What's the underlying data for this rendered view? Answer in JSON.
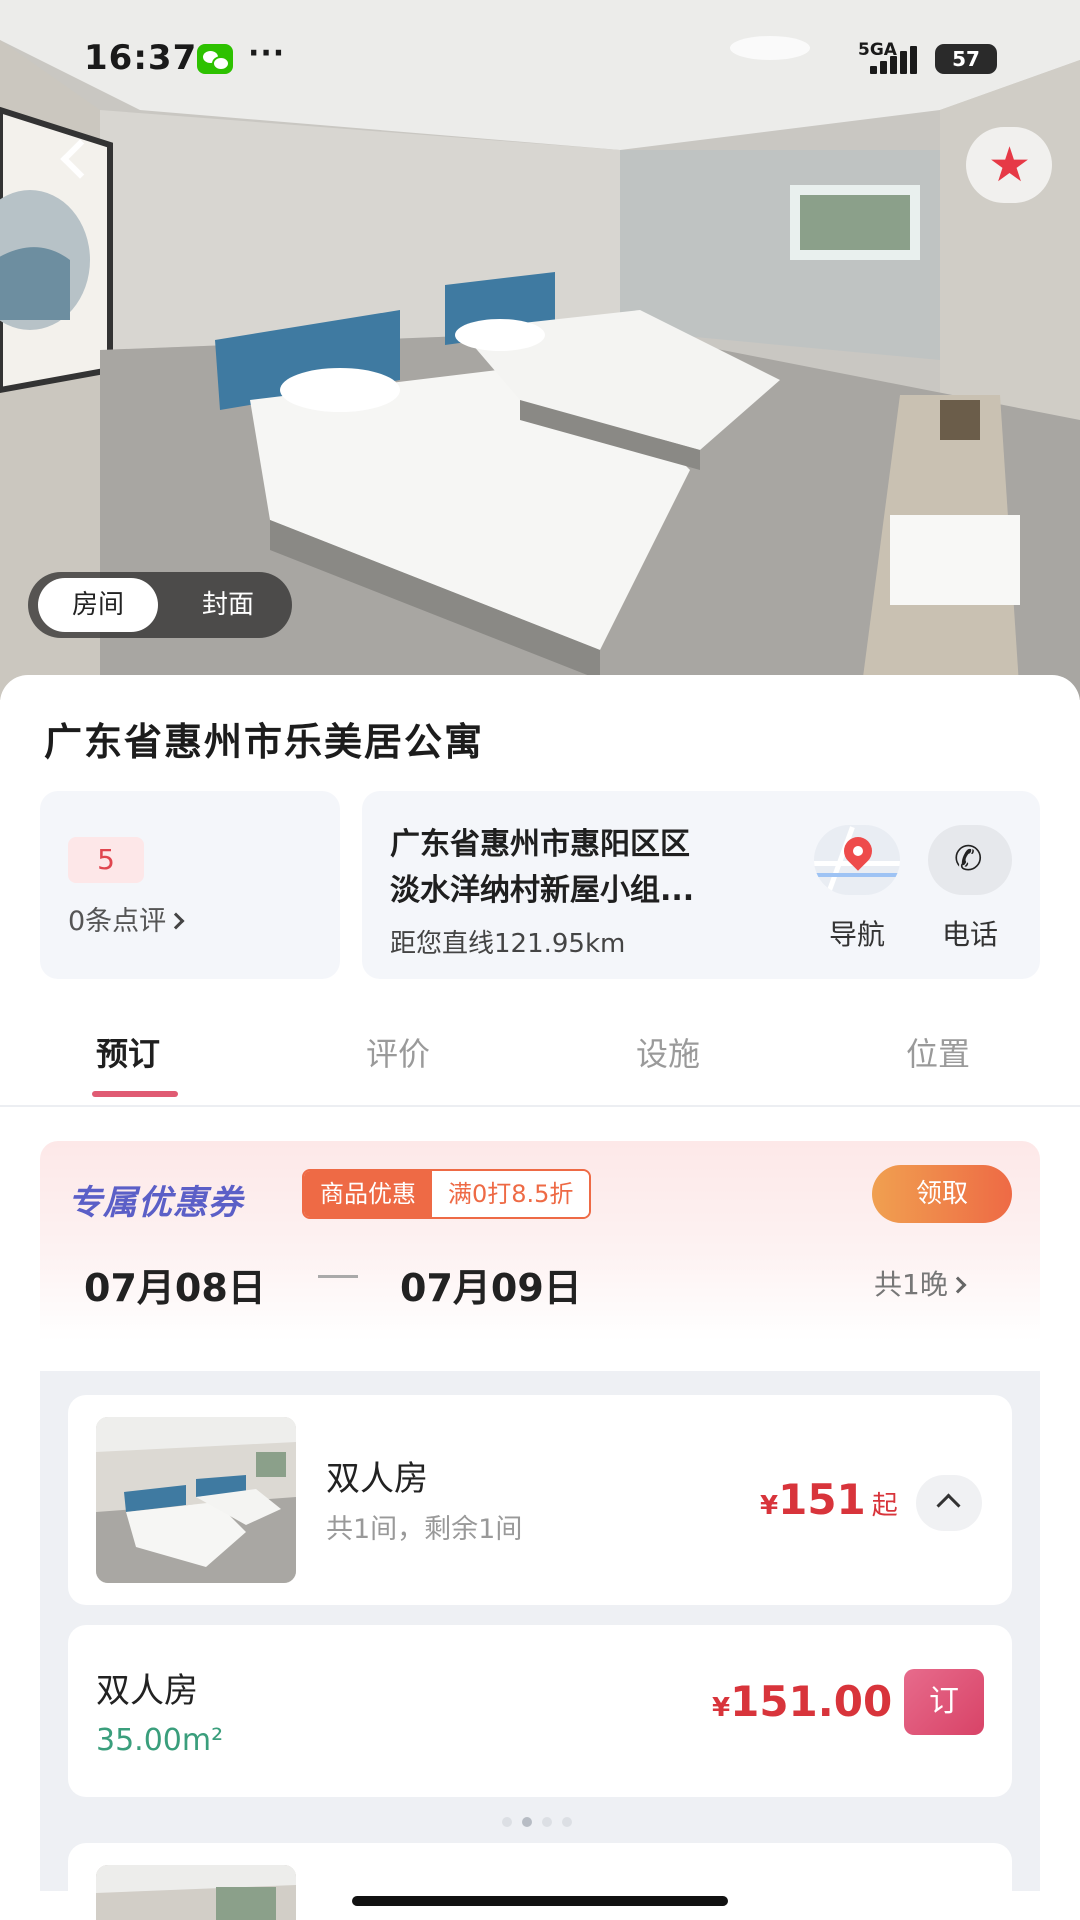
{
  "status_bar": {
    "time": "16:37",
    "extra": "···",
    "network": "5GA",
    "battery": "57",
    "icons": [
      "wechat-icon",
      "signal-icon",
      "battery-icon"
    ]
  },
  "hero": {
    "segments": [
      "房间",
      "封面"
    ],
    "active_segment": "房间",
    "icons": [
      "back-icon",
      "star-icon"
    ]
  },
  "hotel": {
    "name": "广东省惠州市乐美居公寓",
    "score": "5",
    "reviews": "0条点评",
    "address_line1": "广东省惠州市惠阳区区",
    "address_line2": "淡水洋纳村新屋小组...",
    "distance": "距您直线121.95km",
    "nav_label": "导航",
    "phone_label": "电话",
    "icons": [
      "map-pin-icon",
      "phone-icon"
    ]
  },
  "tabs": [
    {
      "label": "预订",
      "active": true
    },
    {
      "label": "评价",
      "active": false
    },
    {
      "label": "设施",
      "active": false
    },
    {
      "label": "位置",
      "active": false
    }
  ],
  "coupon": {
    "title": "专属优惠券",
    "tag_type": "商品优惠",
    "tag_rule": "满0打8.5折",
    "claim": "领取"
  },
  "dates": {
    "checkin": "07月08日",
    "checkout": "07月09日",
    "nights": "共1晚"
  },
  "rooms": [
    {
      "name": "双人房",
      "stock": "共1间，剩余1间",
      "currency": "¥",
      "price": "151",
      "price_suffix": "起",
      "rates": [
        {
          "name": "双人房",
          "area": "35.00m²",
          "currency": "¥",
          "price": "151.00",
          "book": "订"
        }
      ]
    }
  ],
  "colors": {
    "accent": "#d8343b",
    "tab_indicator": "#e05b73",
    "coupon_title": "#5b5fc7",
    "coupon_tag": "#ee6a45",
    "area_text": "#3a9e7c"
  }
}
